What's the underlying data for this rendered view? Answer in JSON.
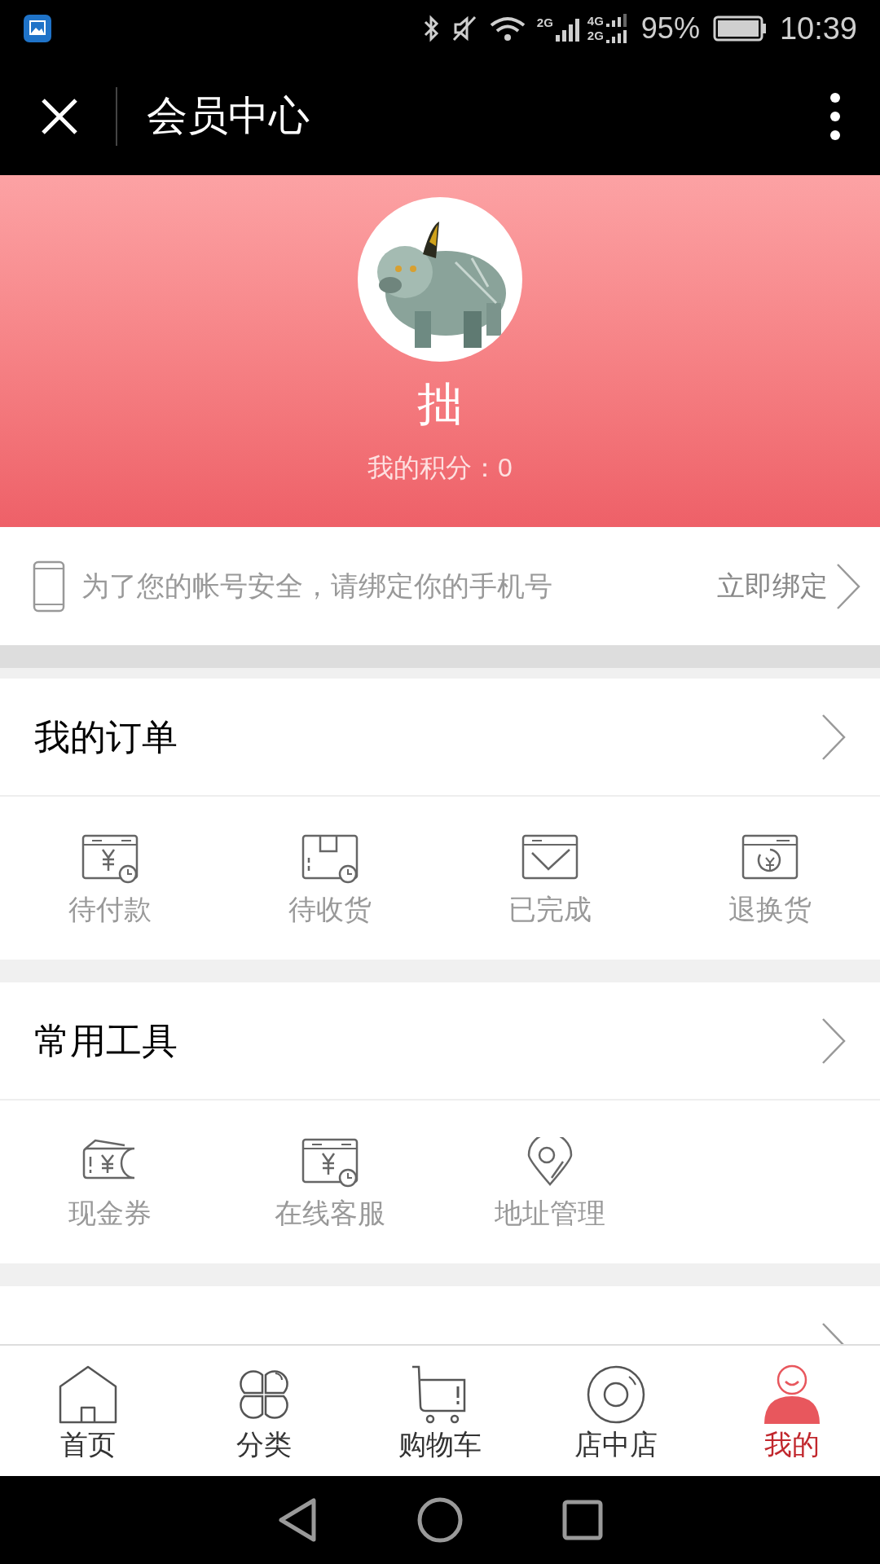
{
  "status_bar": {
    "battery": "95%",
    "time": "10:39",
    "network_1": "2G",
    "network_2": "4G",
    "network_3": "2G"
  },
  "title_bar": {
    "title": "会员中心"
  },
  "profile": {
    "name": "拙",
    "points": "我的积分：0"
  },
  "bind_phone": {
    "message": "为了您的帐号安全，请绑定你的手机号",
    "action": "立即绑定"
  },
  "sections": [
    {
      "title": "我的订单",
      "items": [
        {
          "label": "待付款"
        },
        {
          "label": "待收货"
        },
        {
          "label": "已完成"
        },
        {
          "label": "退换货"
        }
      ]
    },
    {
      "title": "常用工具",
      "items": [
        {
          "label": "现金券"
        },
        {
          "label": "在线客服"
        },
        {
          "label": "地址管理"
        }
      ]
    },
    {
      "kind": "cut"
    }
  ],
  "bottom_nav": [
    {
      "label": "首页",
      "selected": false
    },
    {
      "label": "分类",
      "selected": false
    },
    {
      "label": "购物车",
      "selected": false
    },
    {
      "label": "店中店",
      "selected": false
    },
    {
      "label": "我的",
      "selected": true
    }
  ]
}
